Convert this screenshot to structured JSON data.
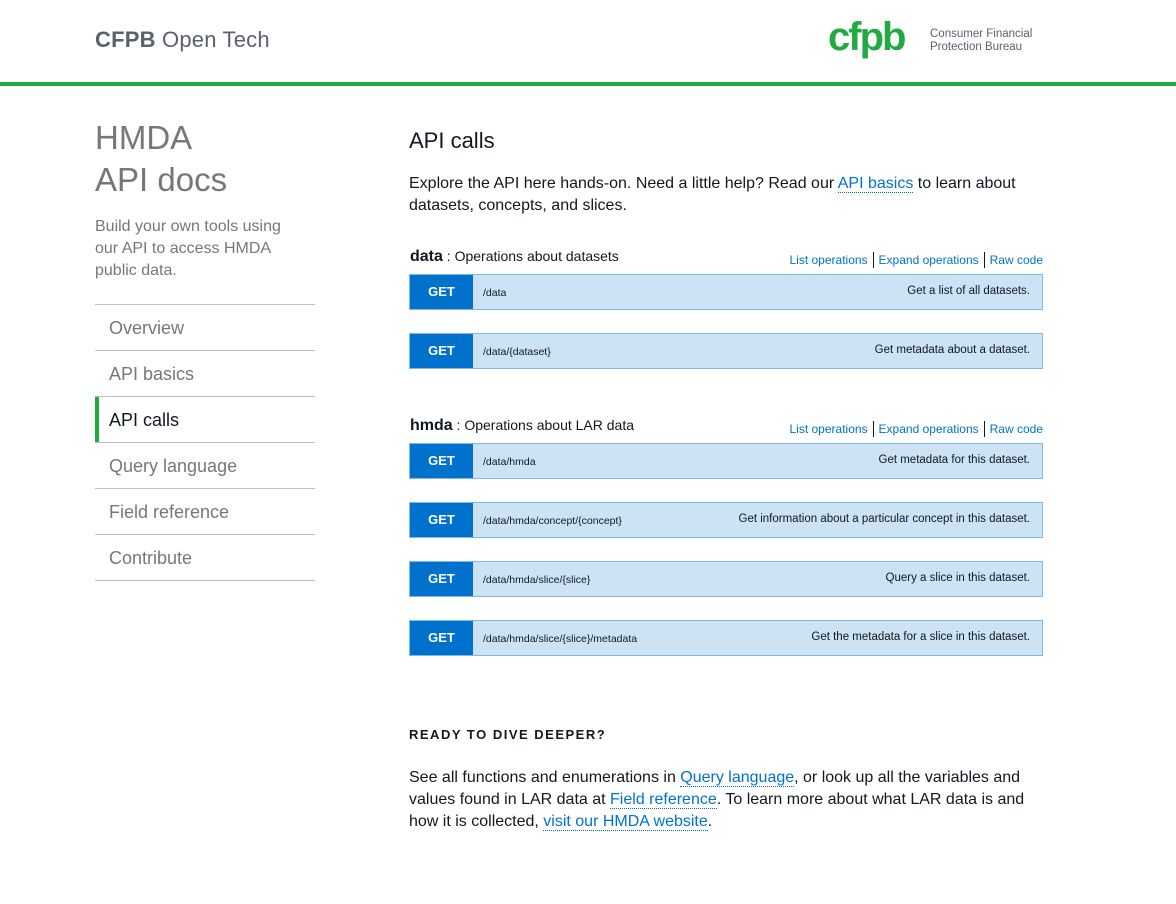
{
  "header": {
    "site_title_strong": "CFPB",
    "site_title_rest": " Open Tech",
    "logo_mark": "cfpb",
    "logo_line1": "Consumer Financial",
    "logo_line2": "Protection Bureau"
  },
  "sidebar": {
    "title_line1": "HMDA",
    "title_line2": "API docs",
    "description": "Build your own tools using our API to access HMDA public data.",
    "items": [
      {
        "label": "Overview"
      },
      {
        "label": "API basics"
      },
      {
        "label": "API calls"
      },
      {
        "label": "Query language"
      },
      {
        "label": "Field reference"
      },
      {
        "label": "Contribute"
      }
    ]
  },
  "main": {
    "title": "API calls",
    "intro_before": "Explore the API here hands-on. Need a little help? Read our ",
    "intro_link": "API basics",
    "intro_after": " to learn about datasets, concepts, and slices."
  },
  "resources": [
    {
      "name": "data",
      "description": " : Operations about datasets",
      "actions": [
        "List operations",
        "Expand operations",
        "Raw code"
      ],
      "operations": [
        {
          "method": "GET",
          "path": "/data",
          "summary": "Get a list of all datasets."
        },
        {
          "method": "GET",
          "path": "/data/{dataset}",
          "summary": "Get metadata about a dataset."
        }
      ]
    },
    {
      "name": "hmda",
      "description": " : Operations about LAR data",
      "actions": [
        "List operations",
        "Expand operations",
        "Raw code"
      ],
      "operations": [
        {
          "method": "GET",
          "path": "/data/hmda",
          "summary": "Get metadata for this dataset."
        },
        {
          "method": "GET",
          "path": "/data/hmda/concept/{concept}",
          "summary": "Get information about a particular concept in this dataset."
        },
        {
          "method": "GET",
          "path": "/data/hmda/slice/{slice}",
          "summary": "Query a slice in this dataset."
        },
        {
          "method": "GET",
          "path": "/data/hmda/slice/{slice}/metadata",
          "summary": "Get the metadata for a slice in this dataset."
        }
      ]
    }
  ],
  "deeper": {
    "heading": "READY TO DIVE DEEPER?",
    "text1": "See all functions and enumerations in ",
    "link1": "Query language",
    "text2": ", or look up all the variables and values found in LAR data at ",
    "link2": "Field reference",
    "text3": ". To learn more about what LAR data is and how it is collected, ",
    "link3": "visit our HMDA website",
    "text4": "."
  },
  "colors": {
    "brand_green": "#20aa3f",
    "link_blue": "#0072ce",
    "op_background": "#cce3f5",
    "method_blue": "#0072ce"
  }
}
